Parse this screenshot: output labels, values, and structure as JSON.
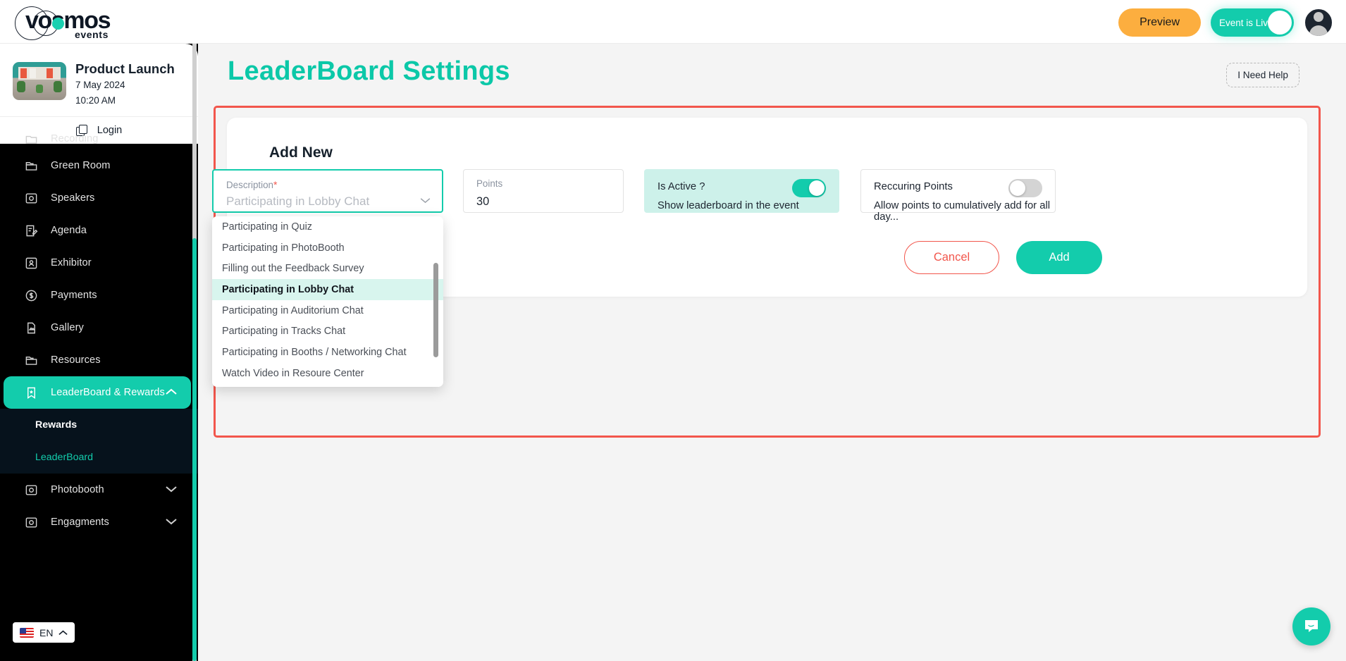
{
  "brand": {
    "name": "vosmos",
    "sub": "events",
    "accent": "#13ccac"
  },
  "topbar": {
    "preview_label": "Preview",
    "live_label": "Event is Live",
    "live_on": true
  },
  "sidebar": {
    "event": {
      "title": "Product Launch",
      "date": "7 May 2024",
      "time": "10:20 AM",
      "login_label": "Login"
    },
    "items": [
      {
        "label": "Recording",
        "icon": "folder-icon",
        "partial": true
      },
      {
        "label": "Green Room",
        "icon": "folder-icon"
      },
      {
        "label": "Speakers",
        "icon": "camera-icon"
      },
      {
        "label": "Agenda",
        "icon": "agenda-icon"
      },
      {
        "label": "Exhibitor",
        "icon": "exhibitor-icon"
      },
      {
        "label": "Payments",
        "icon": "dollar-icon"
      },
      {
        "label": "Gallery",
        "icon": "gallery-icon"
      },
      {
        "label": "Resources",
        "icon": "folder-icon"
      },
      {
        "label": "LeaderBoard & Rewards",
        "icon": "bookmark-star-icon",
        "active": true,
        "chevron": "chevron-up"
      },
      {
        "label": "Photobooth",
        "icon": "camera-icon",
        "chevron": "chevron-down"
      },
      {
        "label": "Engagments",
        "icon": "camera-icon",
        "chevron": "chevron-down"
      }
    ],
    "submenu": [
      {
        "label": "Rewards",
        "current": false
      },
      {
        "label": "LeaderBoard",
        "current": true
      }
    ],
    "language": {
      "code": "EN",
      "flag": "us-flag-icon"
    }
  },
  "main": {
    "page_title": "LeaderBoard Settings",
    "help_label": "I Need Help",
    "card_title": "Add New",
    "description_field": {
      "label": "Description",
      "required_mark": "*",
      "placeholder": "Participating in Lobby Chat"
    },
    "points_field": {
      "label": "Points",
      "value": "30"
    },
    "is_active": {
      "label": "Is Active ?",
      "desc": "Show leaderboard in the event",
      "on": true
    },
    "recurring_points": {
      "label": "Reccuring Points",
      "desc": "Allow points to cumulatively add for all day...",
      "on": false
    },
    "cancel_label": "Cancel",
    "add_label": "Add"
  },
  "dropdown": {
    "options": [
      "Participating in Quiz",
      "Participating in PhotoBooth",
      "Filling out the Feedback Survey",
      "Participating in Lobby Chat",
      "Participating in Auditorium Chat",
      "Participating in Tracks Chat",
      "Participating in Booths / Networking Chat",
      "Watch Video in Resoure Center"
    ],
    "selected": "Participating in Lobby Chat"
  }
}
